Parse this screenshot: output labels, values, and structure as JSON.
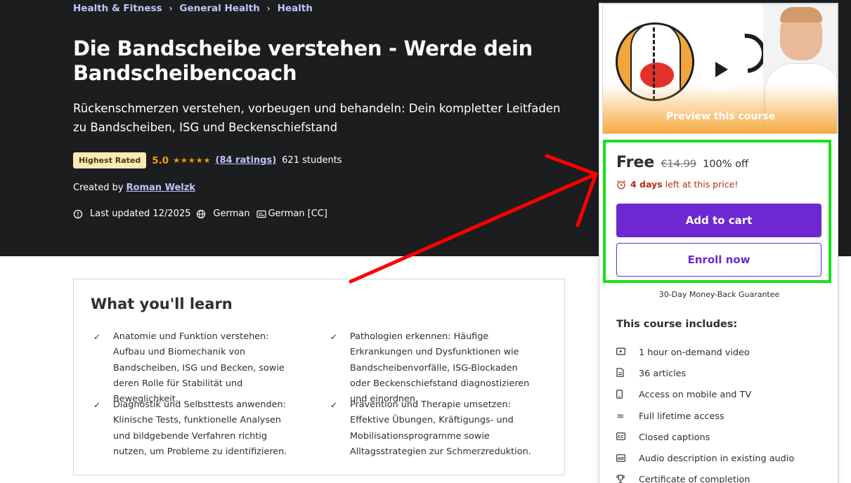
{
  "breadcrumbs": [
    "Health & Fitness",
    "General Health",
    "Health"
  ],
  "title": "Die Bandscheibe verstehen - Werde dein Bandscheibencoach",
  "subtitle": "Rückenschmerzen verstehen, vorbeugen und behandeln: Dein kompletter Leitfaden zu Bandscheiben, ISG und Beckenschiefstand",
  "badge": "Highest Rated",
  "rating": {
    "score": "5.0",
    "stars": "★★★★★",
    "count": "(84 ratings)",
    "students": "621 students"
  },
  "creator": {
    "prefix": "Created by",
    "name": "Roman Welzk"
  },
  "meta": {
    "updated": "Last updated 12/2025",
    "language": "German",
    "captions": "German [CC]"
  },
  "sidebar": {
    "preview_label": "Preview this course",
    "price_free": "Free",
    "price_old": "€14.99",
    "price_off": "100% off",
    "timer_bold": "4 days",
    "timer_rest": "left at this price!",
    "add_to_cart": "Add to cart",
    "enroll_now": "Enroll now",
    "guarantee": "30-Day Money-Back Guarantee",
    "includes_title": "This course includes:",
    "includes": [
      {
        "icon": "video-icon",
        "label": "1 hour on-demand video"
      },
      {
        "icon": "article-icon",
        "label": "36 articles"
      },
      {
        "icon": "mobile-icon",
        "label": "Access on mobile and TV"
      },
      {
        "icon": "infinity-icon",
        "label": "Full lifetime access"
      },
      {
        "icon": "captions-icon",
        "label": "Closed captions"
      },
      {
        "icon": "audio-description-icon",
        "label": "Audio description in existing audio"
      },
      {
        "icon": "trophy-icon",
        "label": "Certificate of completion"
      }
    ]
  },
  "learn": {
    "title": "What you'll learn",
    "items": [
      "Anatomie und Funktion verstehen: Aufbau und Biomechanik von Bandscheiben, ISG und Becken, sowie deren Rolle für Stabilität und Beweglichkeit.",
      "Pathologien erkennen: Häufige Erkrankungen und Dysfunktionen wie Bandscheibenvorfälle, ISG-Blockaden oder Beckenschiefstand diagnostizieren und einordnen.",
      "Diagnostik und Selbsttests anwenden: Klinische Tests, funktionelle Analysen und bildgebende Verfahren richtig nutzen, um Probleme zu identifizieren.",
      "Prävention und Therapie umsetzen: Effektive Übungen, Kräftigungs- und Mobilisationsprogramme sowie Alltagsstrategien zur Schmerzreduktion."
    ]
  },
  "colors": {
    "hero_bg": "#1c1d1f",
    "accent_purple": "#6d28d2",
    "link_lavender": "#c0c4fc",
    "star_orange": "#f69c08",
    "highlight_green": "#16e21a",
    "annotation_red": "#ff0000"
  }
}
